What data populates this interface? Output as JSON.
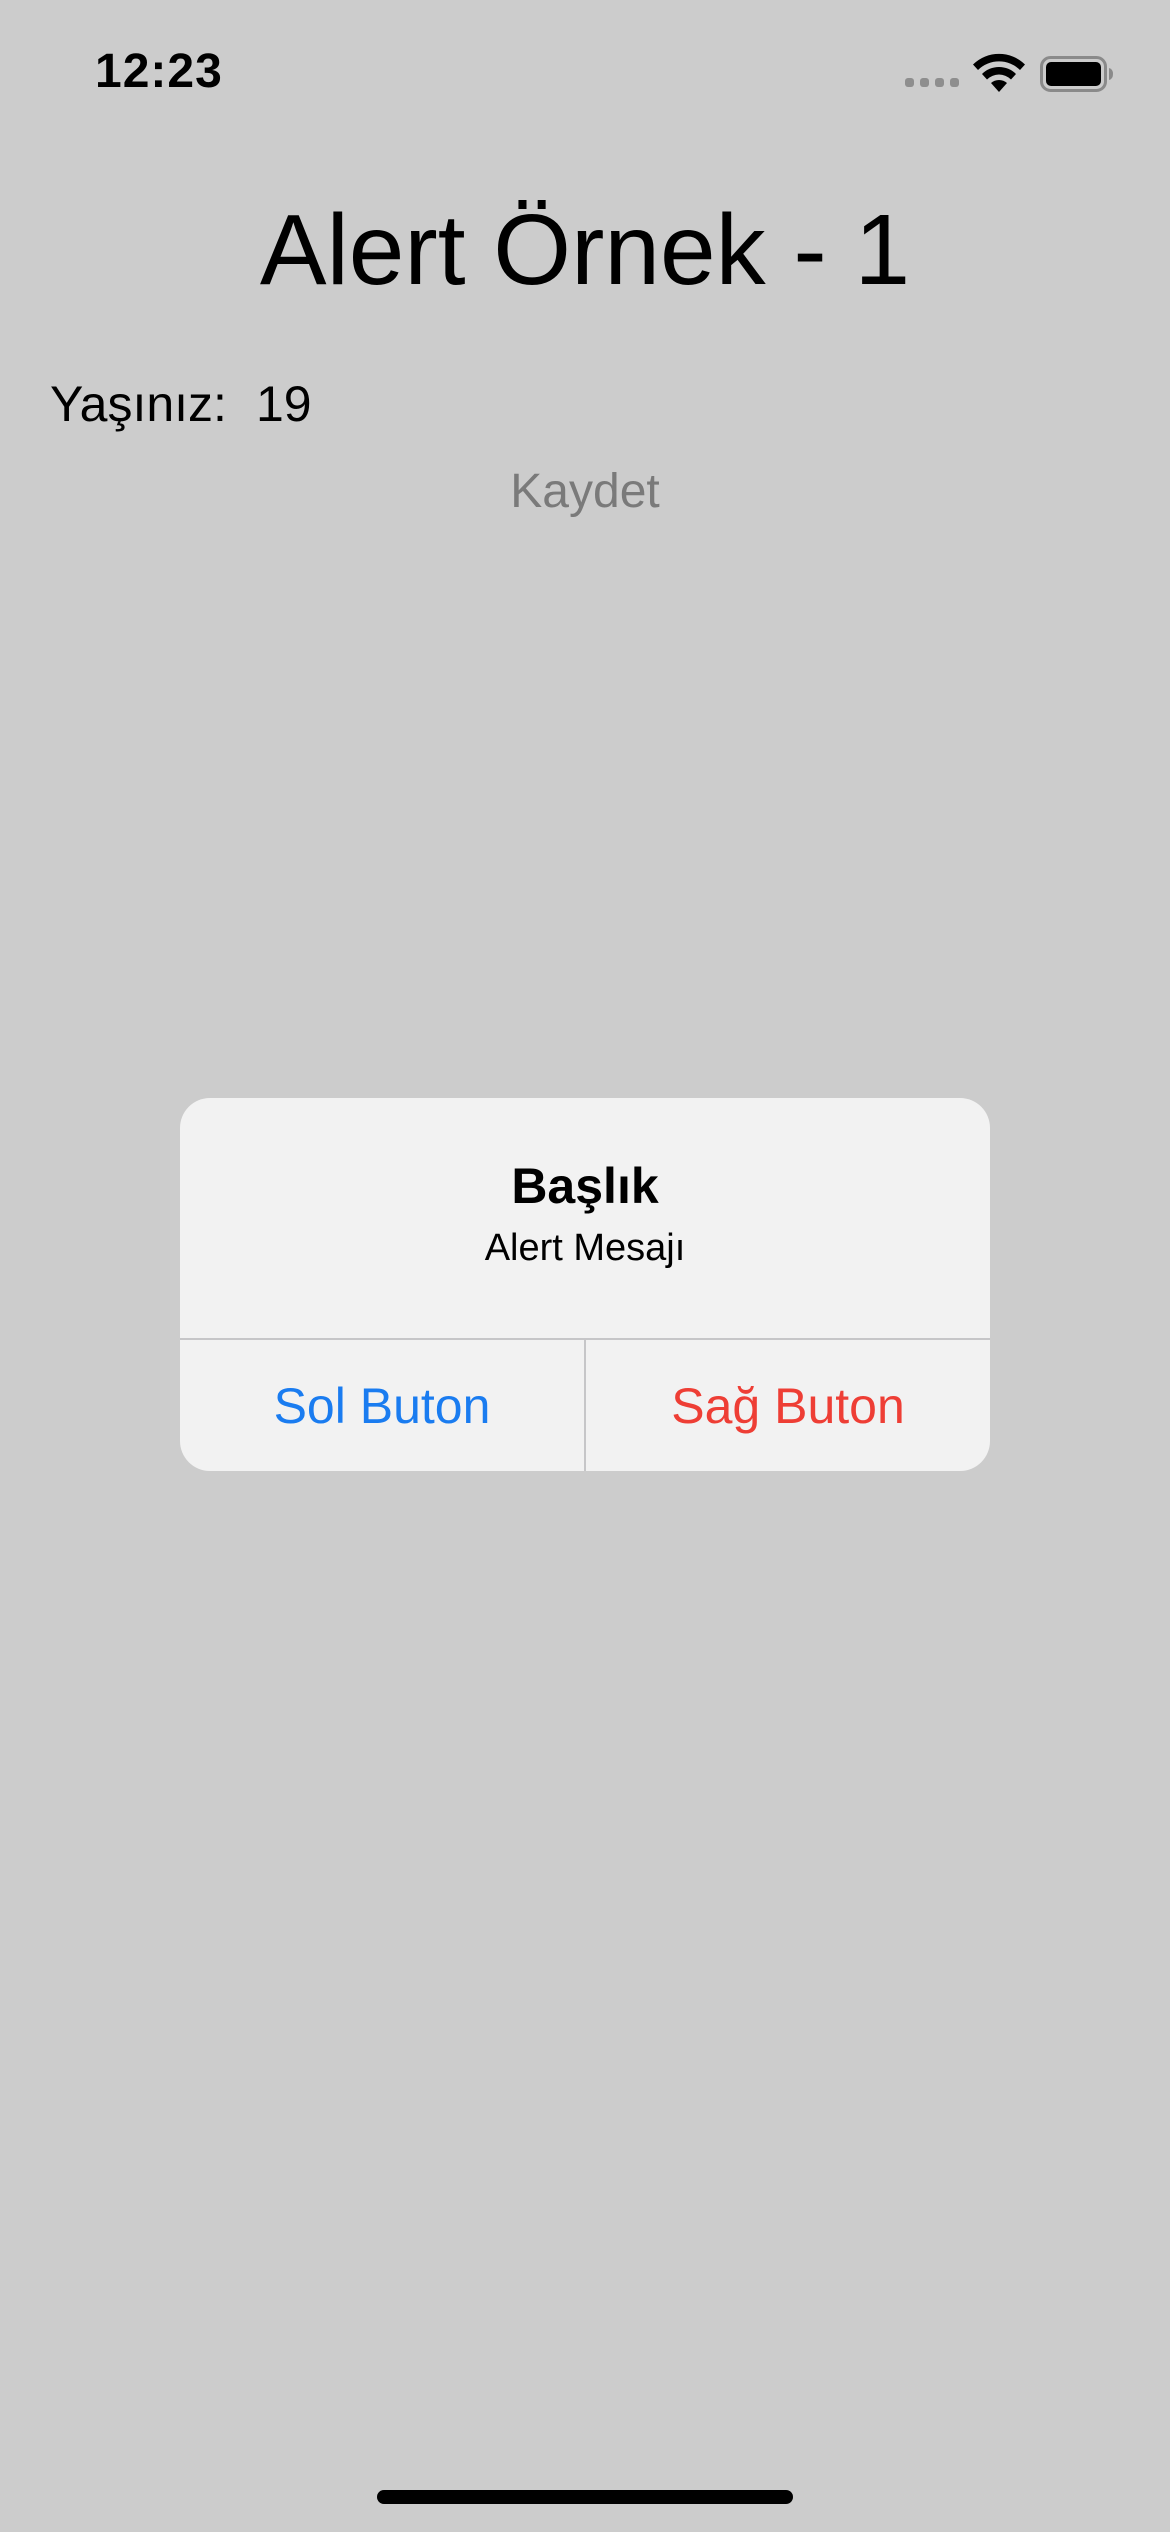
{
  "status_bar": {
    "time": "12:23"
  },
  "screen": {
    "title": "Alert Örnek - 1",
    "age_label": "Yaşınız:",
    "age_value": "19",
    "save_label": "Kaydet"
  },
  "alert": {
    "title": "Başlık",
    "message": "Alert Mesajı",
    "left_button": "Sol Buton",
    "right_button": "Sağ Buton"
  },
  "colors": {
    "background": "#cccccc",
    "alert_background": "#f2f2f2",
    "left_button": "#1a7cf0",
    "right_button": "#ee3e35",
    "save_text": "#7a7a7a"
  },
  "icons": [
    "cellular-signal-icon",
    "wifi-icon",
    "battery-icon"
  ]
}
